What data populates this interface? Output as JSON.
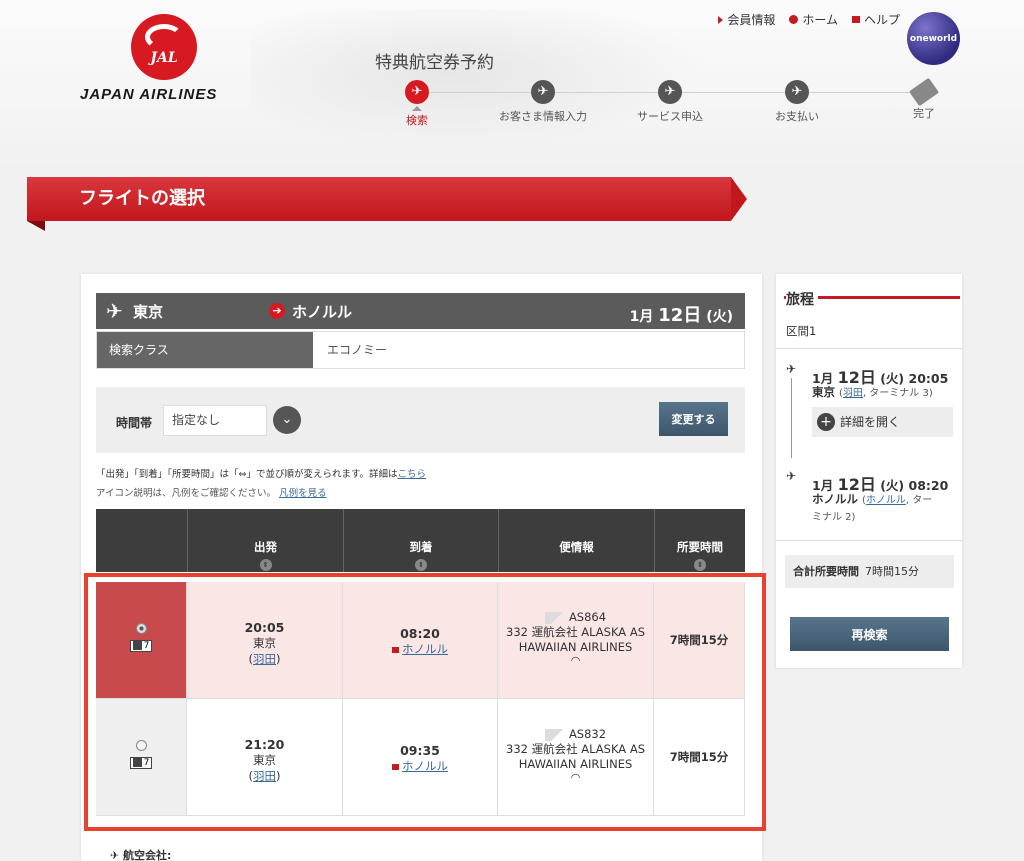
{
  "header": {
    "brand": "JAPAN AIRLINES",
    "logo_text": "JAL",
    "page_title": "特典航空券予約",
    "oneworld": "oneworld",
    "links": [
      "会員情報",
      "ホーム",
      "ヘルプ"
    ],
    "steps": [
      {
        "label": "検索",
        "active": true
      },
      {
        "label": "お客さま情報入力",
        "active": false
      },
      {
        "label": "サービス申込",
        "active": false
      },
      {
        "label": "お支払い",
        "active": false
      },
      {
        "label": "完了",
        "active": false
      }
    ]
  },
  "banner": {
    "title": "フライトの選択"
  },
  "route": {
    "from": "東京",
    "to": "ホノルル",
    "date_month": "1月",
    "date_day": "12日",
    "date_dow": "(火)"
  },
  "search_class": {
    "label": "検索クラス",
    "value": "エコノミー"
  },
  "filter": {
    "label": "時間帯",
    "selected": "指定なし",
    "button": "変更する"
  },
  "notes": {
    "line1": "「出発」「到着」「所要時間」は「⇔」で並び順が変えられます。詳細は",
    "line1_link": "こちら",
    "line2": "アイコン説明は、凡例をご確認ください。",
    "line2_link": "凡例を見る"
  },
  "table": {
    "headers": [
      "出発",
      "到着",
      "便情報",
      "所要時間"
    ],
    "rows": [
      {
        "selected": true,
        "seats": "7",
        "dep_time": "20:05",
        "dep_city": "東京",
        "dep_airport": "羽田",
        "arr_time": "08:20",
        "arr_airport": "ホノルル",
        "flight_no": "AS864",
        "flight_info": "332 運航会社 ALASKA AS",
        "flight_info2": "HAWAIIAN AIRLINES",
        "duration": "7時間15分"
      },
      {
        "selected": false,
        "seats": "7",
        "dep_time": "21:20",
        "dep_city": "東京",
        "dep_airport": "羽田",
        "arr_time": "09:35",
        "arr_airport": "ホノルル",
        "flight_no": "AS832",
        "flight_info": "332 運航会社 ALASKA AS",
        "flight_info2": "HAWAIIAN AIRLINES",
        "duration": "7時間15分"
      }
    ]
  },
  "airline_label": "航空会社:",
  "sidebar": {
    "title": "旅程",
    "segment": "区間1",
    "dep": {
      "month": "1月",
      "day": "12日",
      "dow": "(火)",
      "time": "20:05",
      "city": "東京",
      "airport": "羽田",
      "terminal": "ターミナル 3"
    },
    "detail_button": "詳細を開く",
    "arr": {
      "month": "1月",
      "day": "12日",
      "dow": "(火)",
      "time": "08:20",
      "city": "ホノルル",
      "airport": "ホノルル",
      "terminal_a": "ター",
      "terminal_b": "ミナル 2"
    },
    "total_label": "合計所要時間",
    "total_value": "7時間15分",
    "research_button": "再検索"
  }
}
